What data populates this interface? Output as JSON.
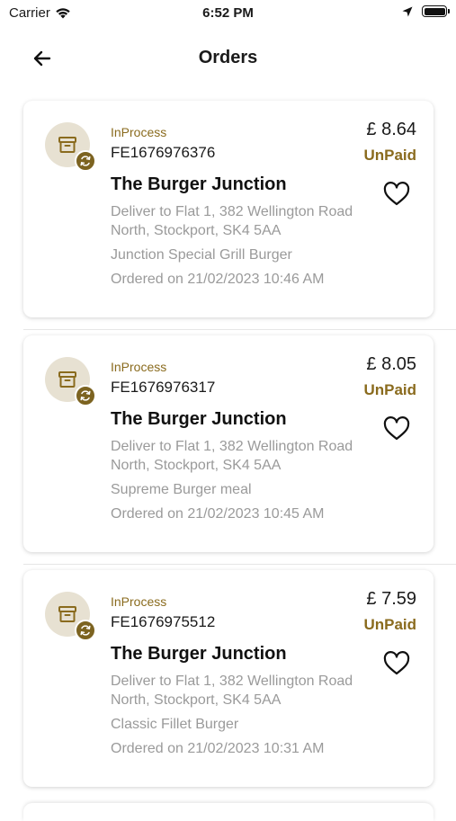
{
  "status_bar": {
    "carrier": "Carrier",
    "time": "6:52 PM"
  },
  "nav": {
    "title": "Orders"
  },
  "orders": [
    {
      "status": "InProcess",
      "order_id": "FE1676976376",
      "restaurant": "The Burger Junction",
      "address": "Deliver to Flat 1, 382 Wellington Road North, Stockport, SK4 5AA",
      "item": "Junction Special Grill Burger",
      "ordered_on": "Ordered on 21/02/2023 10:46 AM",
      "price": "£ 8.64",
      "payment_status": "UnPaid"
    },
    {
      "status": "InProcess",
      "order_id": "FE1676976317",
      "restaurant": "The Burger Junction",
      "address": "Deliver to Flat 1, 382 Wellington Road North, Stockport, SK4 5AA",
      "item": "Supreme Burger meal",
      "ordered_on": "Ordered on 21/02/2023 10:45 AM",
      "price": "£ 8.05",
      "payment_status": "UnPaid"
    },
    {
      "status": "InProcess",
      "order_id": "FE1676975512",
      "restaurant": "The Burger Junction",
      "address": "Deliver to Flat 1, 382 Wellington Road North, Stockport, SK4 5AA",
      "item": "Classic Fillet Burger",
      "ordered_on": "Ordered on 21/02/2023 10:31 AM",
      "price": "£ 7.59",
      "payment_status": "UnPaid"
    }
  ],
  "colors": {
    "accent": "#8a6b1e",
    "avatar_bg": "#e7e1d2",
    "badge_bg": "#7c6320",
    "muted_text": "#9a9a9a"
  },
  "icons": {
    "back": "arrow-left-icon",
    "order": "archive-box-icon",
    "status": "sync-icon",
    "favorite": "heart-icon"
  }
}
